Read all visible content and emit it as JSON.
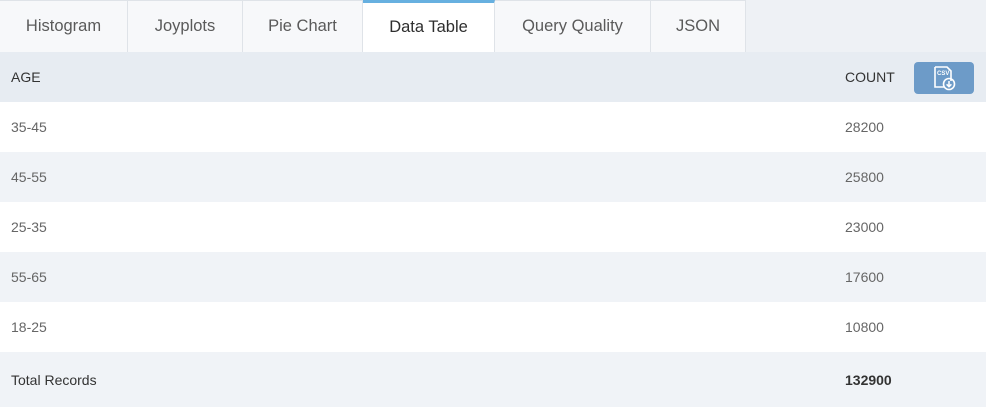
{
  "tabs": [
    {
      "label": "Histogram",
      "active": false
    },
    {
      "label": "Joyplots",
      "active": false
    },
    {
      "label": "Pie Chart",
      "active": false
    },
    {
      "label": "Data Table",
      "active": true
    },
    {
      "label": "Query Quality",
      "active": false
    },
    {
      "label": "JSON",
      "active": false
    }
  ],
  "table": {
    "columns": {
      "age": "AGE",
      "count": "COUNT"
    },
    "rows": [
      {
        "age": "35-45",
        "count": "28200"
      },
      {
        "age": "45-55",
        "count": "25800"
      },
      {
        "age": "25-35",
        "count": "23000"
      },
      {
        "age": "55-65",
        "count": "17600"
      },
      {
        "age": "18-25",
        "count": "10800"
      }
    ],
    "total": {
      "label": "Total Records",
      "count": "132900"
    }
  },
  "export": {
    "icon": "csv-download-icon",
    "text": "CSV"
  },
  "colors": {
    "accent": "#67b0e0",
    "button": "#6d9bc8"
  }
}
